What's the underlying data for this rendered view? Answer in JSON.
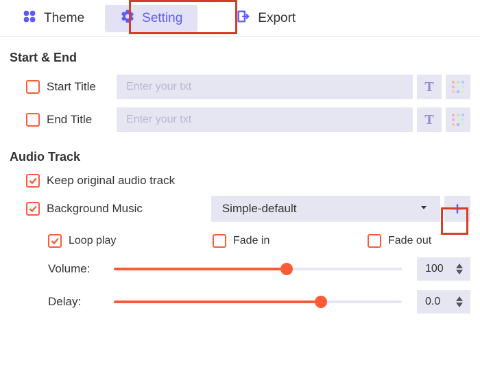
{
  "tabs": {
    "theme": {
      "label": "Theme"
    },
    "setting": {
      "label": "Setting"
    },
    "export": {
      "label": "Export"
    }
  },
  "sections": {
    "start_end": "Start & End",
    "audio_track": "Audio Track"
  },
  "start_end": {
    "start_label": "Start Title",
    "end_label": "End Title",
    "placeholder": "Enter your txt"
  },
  "audio": {
    "keep_original": "Keep original audio track",
    "bg_music": "Background Music",
    "dropdown_value": "Simple-default",
    "loop_play": "Loop play",
    "fade_in": "Fade in",
    "fade_out": "Fade out",
    "volume_label": "Volume:",
    "delay_label": "Delay:",
    "volume_value": "100",
    "delay_value": "0.0"
  }
}
